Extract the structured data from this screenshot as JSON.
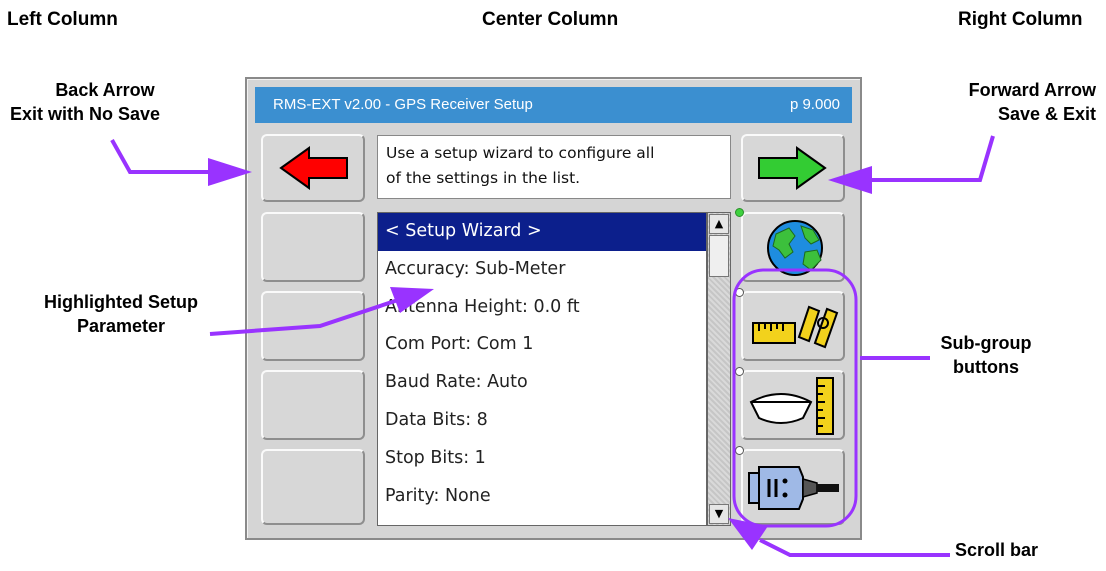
{
  "columns": {
    "left": "Left Column",
    "center": "Center Column",
    "right": "Right Column"
  },
  "callouts": {
    "back_line1": "Back Arrow",
    "back_line2": "Exit with No Save",
    "forward_line1": "Forward Arrow",
    "forward_line2": "Save & Exit",
    "highlight_line1": "Highlighted Setup",
    "highlight_line2": "Parameter",
    "subgroup_line1": "Sub-group",
    "subgroup_line2": "buttons",
    "scrollbar": "Scroll bar"
  },
  "screen": {
    "title": "RMS-EXT v2.00 - GPS Receiver Setup",
    "page": "p 9.000",
    "message_line1": "Use a setup wizard to configure all",
    "message_line2": "of the settings in the list.",
    "list_items": [
      "< Setup Wizard >",
      "Accuracy: Sub-Meter",
      "Antenna Height: 0.0 ft",
      "Com Port: Com 1",
      "Baud Rate: Auto",
      "Data Bits: 8",
      "Stop Bits: 1",
      "Parity: None"
    ],
    "selected_index": 0,
    "scroll_up": "▲",
    "scroll_down": "▼"
  },
  "icons": {
    "back": "back-arrow-icon",
    "forward": "forward-arrow-icon",
    "globe": "globe-icon",
    "antenna_height": "antenna-height-icon",
    "receiver": "gps-receiver-icon",
    "com_port": "serial-port-icon"
  },
  "colors": {
    "title_bar": "#3b8fd0",
    "selection": "#0c1f8c",
    "back_arrow": "#ff0000",
    "forward_arrow": "#33cc33",
    "callout_arrow": "#9933ff",
    "indicator_active": "#3fd13f"
  }
}
